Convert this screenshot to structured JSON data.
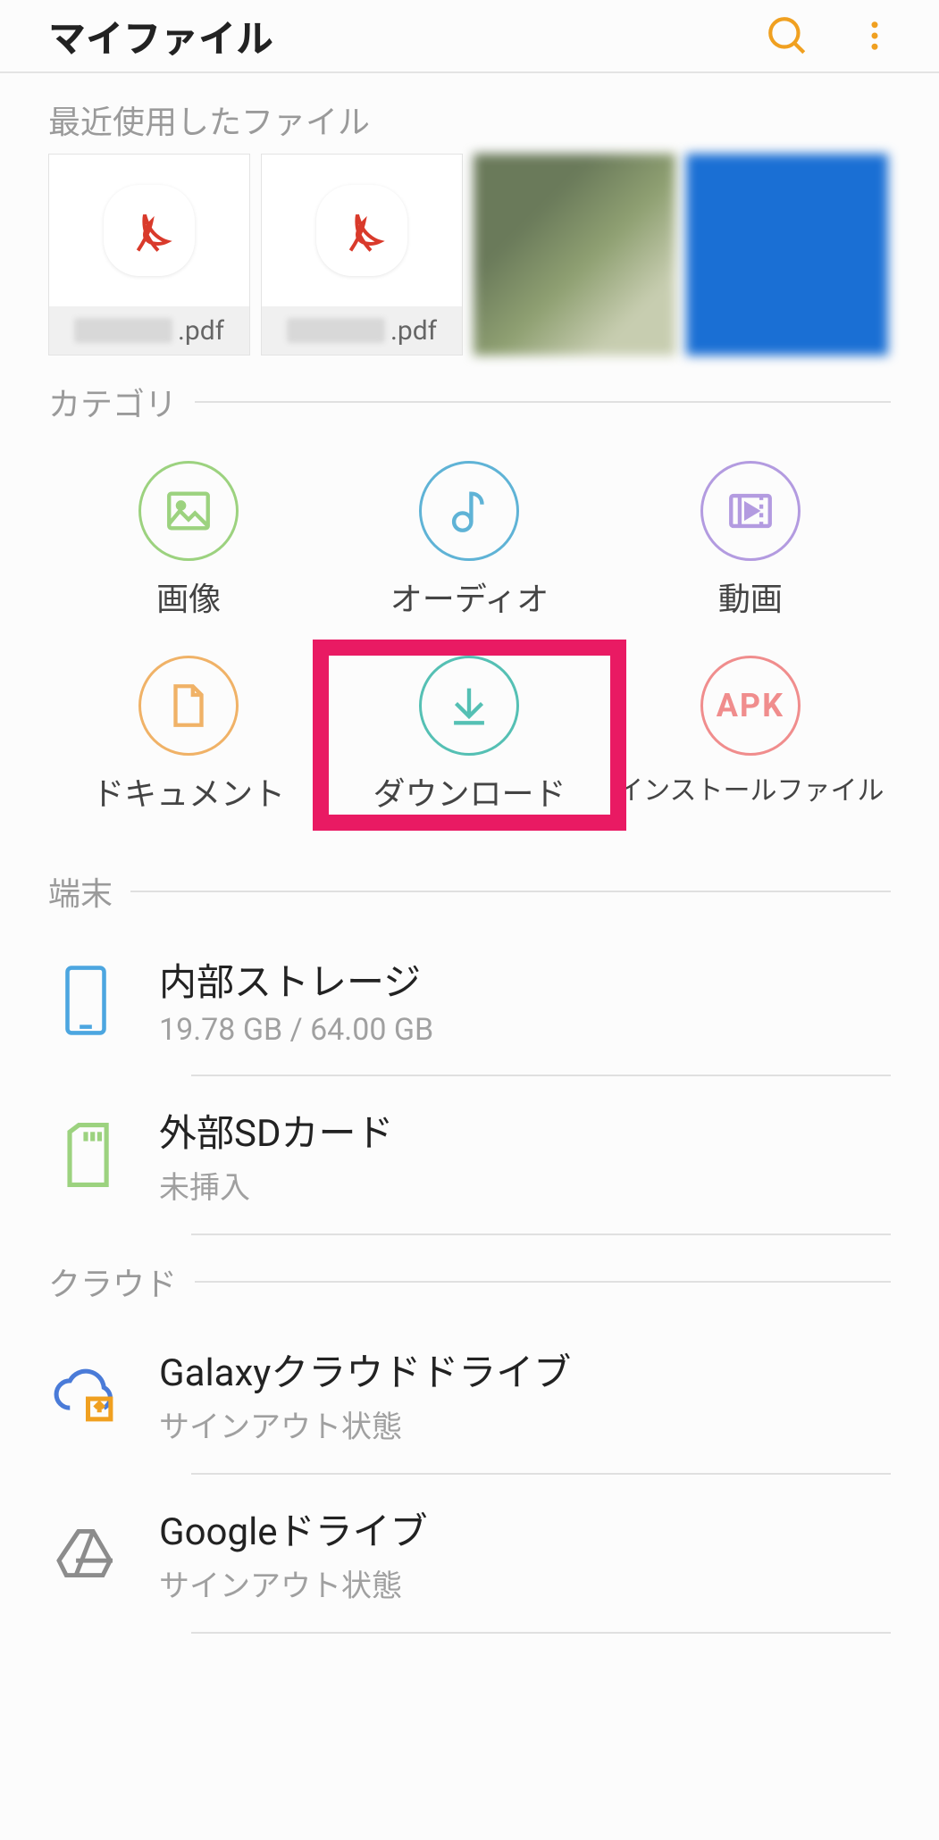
{
  "header": {
    "title": "マイファイル"
  },
  "recent": {
    "label": "最近使用したファイル",
    "items": [
      {
        "ext": ".pdf"
      },
      {
        "ext": ".pdf"
      }
    ]
  },
  "categories": {
    "label": "カテゴリ",
    "items": {
      "images": {
        "label": "画像"
      },
      "audio": {
        "label": "オーディオ"
      },
      "video": {
        "label": "動画"
      },
      "documents": {
        "label": "ドキュメント"
      },
      "downloads": {
        "label": "ダウンロード"
      },
      "apk": {
        "label": "インストールファイル",
        "badge": "APK"
      }
    }
  },
  "device": {
    "label": "端末",
    "internal": {
      "title": "内部ストレージ",
      "sub": "19.78 GB / 64.00 GB"
    },
    "sd": {
      "title": "外部SDカード",
      "sub": "未挿入"
    }
  },
  "cloud": {
    "label": "クラウド",
    "galaxy": {
      "title": "Galaxyクラウドドライブ",
      "sub": "サインアウト状態"
    },
    "gdrive": {
      "title": "Googleドライブ",
      "sub": "サインアウト状態"
    }
  },
  "colors": {
    "accent": "#f0a020",
    "highlight": "#e91a63"
  }
}
